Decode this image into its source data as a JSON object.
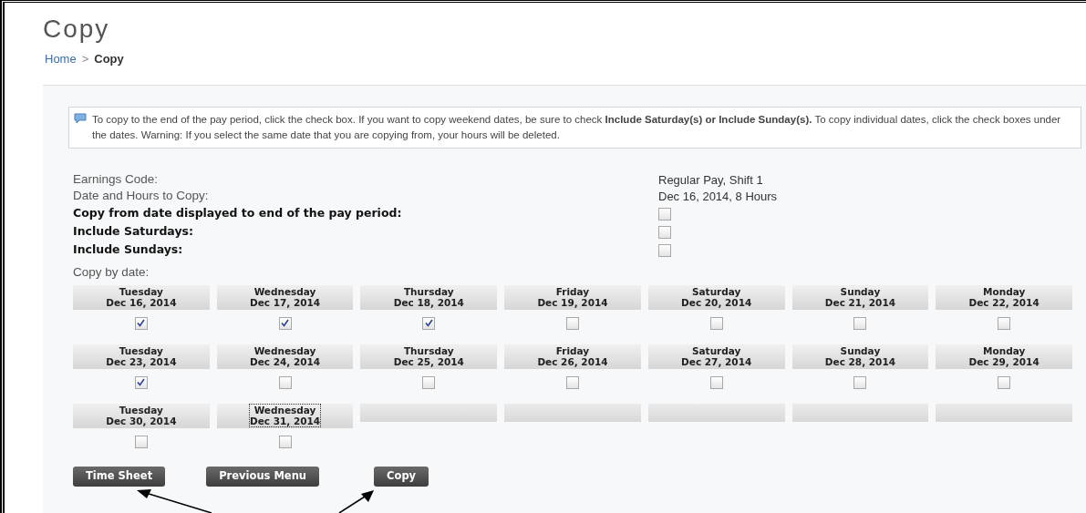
{
  "page_title": "Copy",
  "breadcrumb": [
    {
      "label": "Home",
      "kind": "link"
    },
    {
      "label": ">",
      "kind": "separator"
    },
    {
      "label": "Copy",
      "kind": "current"
    }
  ],
  "info": "To copy to the end of the pay period, click the check box. If you want to copy weekend dates, be sure to check **Include Saturday(s) or Include Sunday(s).** To copy individual dates, click the check boxes under the dates. Warning: If you select the same date that you are copying from, your hours will be deleted.",
  "details": [
    {
      "label": "Earnings Code:",
      "value": "Regular Pay, Shift 1"
    },
    {
      "label": "Date and Hours to Copy:",
      "value": "Dec 16, 2014, 8 Hours"
    }
  ],
  "options": [
    {
      "label": "Copy from date displayed to end of the pay period:",
      "checked": false
    },
    {
      "label": "Include Saturdays:",
      "checked": false
    },
    {
      "label": "Include Sundays:",
      "checked": false
    }
  ],
  "copy_by_date_label": "Copy by date:",
  "days": [
    {
      "kind": "date",
      "day": "Tuesday",
      "date": "Dec 16, 2014",
      "checked": true,
      "focused": false
    },
    {
      "kind": "date",
      "day": "Wednesday",
      "date": "Dec 17, 2014",
      "checked": true,
      "focused": false
    },
    {
      "kind": "date",
      "day": "Thursday",
      "date": "Dec 18, 2014",
      "checked": true,
      "focused": false
    },
    {
      "kind": "date",
      "day": "Friday",
      "date": "Dec 19, 2014",
      "checked": false,
      "focused": false
    },
    {
      "kind": "date",
      "day": "Saturday",
      "date": "Dec 20, 2014",
      "checked": false,
      "focused": false
    },
    {
      "kind": "date",
      "day": "Sunday",
      "date": "Dec 21, 2014",
      "checked": false,
      "focused": false
    },
    {
      "kind": "date",
      "day": "Monday",
      "date": "Dec 22, 2014",
      "checked": false,
      "focused": false
    },
    {
      "kind": "date",
      "day": "Tuesday",
      "date": "Dec 23, 2014",
      "checked": true,
      "focused": false
    },
    {
      "kind": "date",
      "day": "Wednesday",
      "date": "Dec 24, 2014",
      "checked": false,
      "focused": false
    },
    {
      "kind": "date",
      "day": "Thursday",
      "date": "Dec 25, 2014",
      "checked": false,
      "focused": false
    },
    {
      "kind": "date",
      "day": "Friday",
      "date": "Dec 26, 2014",
      "checked": false,
      "focused": false
    },
    {
      "kind": "date",
      "day": "Saturday",
      "date": "Dec 27, 2014",
      "checked": false,
      "focused": false
    },
    {
      "kind": "date",
      "day": "Sunday",
      "date": "Dec 28, 2014",
      "checked": false,
      "focused": false
    },
    {
      "kind": "date",
      "day": "Monday",
      "date": "Dec 29, 2014",
      "checked": false,
      "focused": false
    },
    {
      "kind": "date",
      "day": "Tuesday",
      "date": "Dec 30, 2014",
      "checked": false,
      "focused": false
    },
    {
      "kind": "date",
      "day": "Wednesday",
      "date": "Dec 31, 2014",
      "checked": false,
      "focused": true
    },
    {
      "kind": "blank"
    },
    {
      "kind": "blank"
    },
    {
      "kind": "blank"
    },
    {
      "kind": "blank"
    },
    {
      "kind": "blank"
    }
  ],
  "buttons": [
    "Time Sheet",
    "Previous Menu",
    "Copy"
  ]
}
